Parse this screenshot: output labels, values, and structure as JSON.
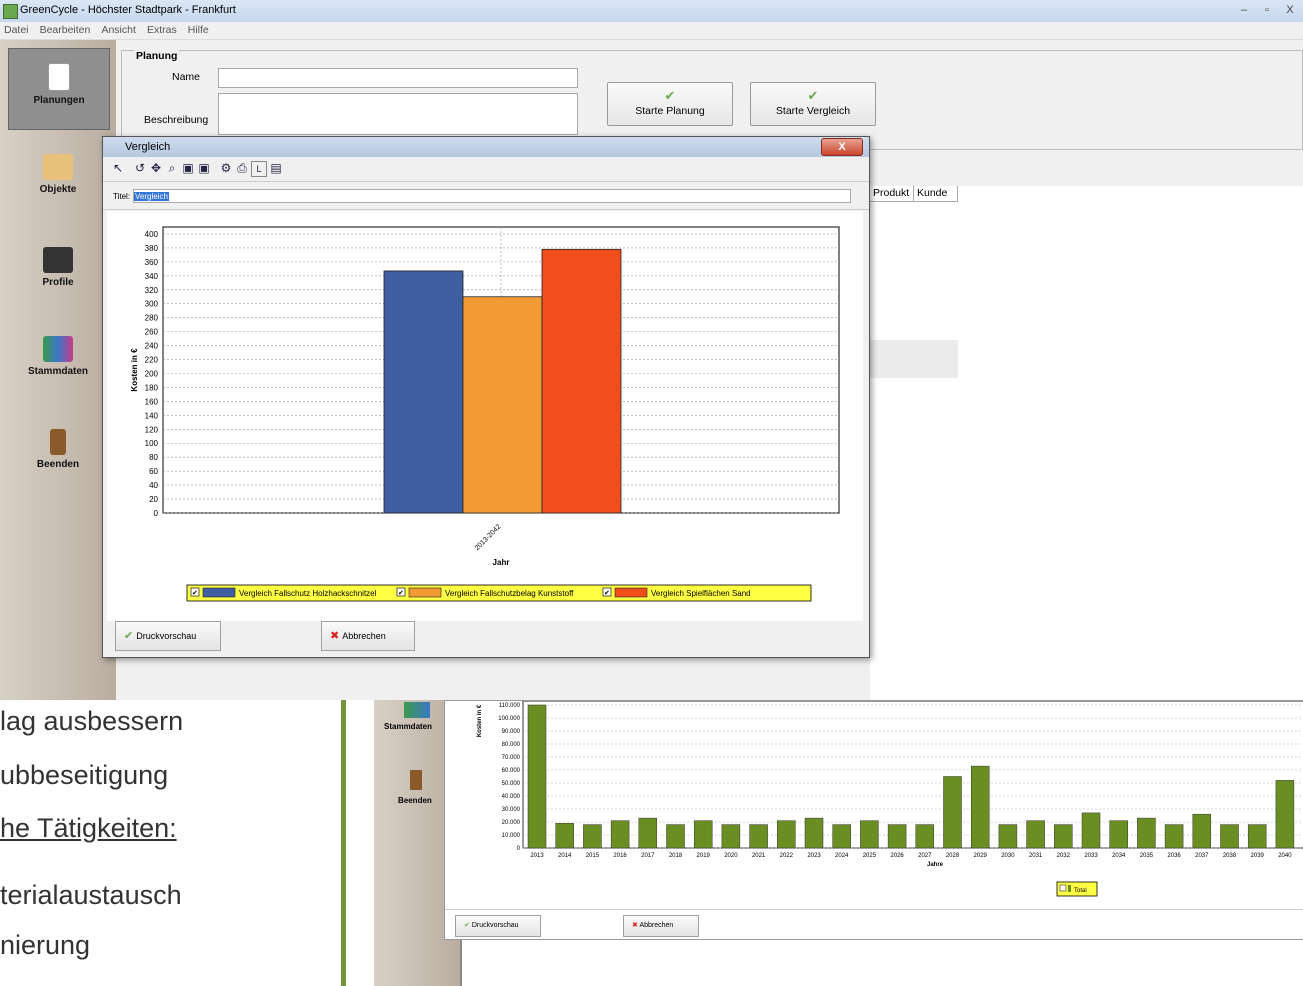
{
  "window": {
    "title": "GreenCycle - Höchster Stadtpark - Frankfurt",
    "buttons": {
      "minimize": "–",
      "maximize": "▫",
      "close": "X"
    }
  },
  "menu": {
    "items": [
      "Datei",
      "Bearbeiten",
      "Ansicht",
      "Extras",
      "Hilfe"
    ]
  },
  "sidebar": {
    "items": [
      {
        "label": "Planungen",
        "icon": "document-icon"
      },
      {
        "label": "Objekte",
        "icon": "map-icon"
      },
      {
        "label": "Profile",
        "icon": "monitor-icon"
      },
      {
        "label": "Stammdaten",
        "icon": "books-icon"
      },
      {
        "label": "Beenden",
        "icon": "door-icon"
      }
    ]
  },
  "planung": {
    "legend": "Planung",
    "name_label": "Name",
    "beschreibung_label": "Beschreibung",
    "name_value": "",
    "beschreibung_value": "",
    "start_planung": "Starte Planung",
    "start_vergleich": "Starte Vergleich"
  },
  "table": {
    "columns": [
      "Produkt",
      "Kunde"
    ]
  },
  "dialog": {
    "title": "Vergleich",
    "close": "X",
    "titel_label": "Titel:",
    "titel_value": "Vergleich",
    "druckvorschau": "Druckvorschau",
    "abbrechen": "Abbrechen"
  },
  "chart_data": [
    {
      "type": "bar",
      "categories": [
        "2013-2042"
      ],
      "series": [
        {
          "name": "Vergleich Fallschutz Holzhackschnitzel",
          "values": [
            347
          ],
          "color": "#3f5fa0"
        },
        {
          "name": "Vergleich Fallschutzbelag Kunststoff",
          "values": [
            310
          ],
          "color": "#f29b35"
        },
        {
          "name": "Vergleich Spielflächen Sand",
          "values": [
            378
          ],
          "color": "#f04e1a"
        }
      ],
      "xlabel": "Jahr",
      "ylabel": "Kosten in €",
      "ylim": [
        0,
        410
      ],
      "yticks": [
        0,
        20,
        40,
        60,
        80,
        100,
        120,
        140,
        160,
        180,
        200,
        220,
        240,
        260,
        280,
        300,
        320,
        340,
        360,
        380,
        400
      ],
      "grid": true,
      "legend": "bottom"
    },
    {
      "type": "bar",
      "categories": [
        "2013",
        "2014",
        "2015",
        "2016",
        "2017",
        "2018",
        "2019",
        "2020",
        "2021",
        "2022",
        "2023",
        "2024",
        "2025",
        "2026",
        "2027",
        "2028",
        "2029",
        "2030",
        "2031",
        "2032",
        "2033",
        "2034",
        "2035",
        "2036",
        "2037",
        "2038",
        "2039",
        "2040"
      ],
      "series": [
        {
          "name": "Total",
          "values": [
            110000,
            19000,
            18000,
            21000,
            23000,
            18000,
            21000,
            18000,
            18000,
            21000,
            23000,
            18000,
            21000,
            18000,
            18000,
            55000,
            63000,
            18000,
            21000,
            18000,
            27000,
            21000,
            23000,
            18000,
            26000,
            18000,
            18000,
            52000
          ],
          "color": "#6b8e23"
        }
      ],
      "xlabel": "Jahre",
      "ylabel": "Kosten in €",
      "yticks": [
        "0",
        "10.000",
        "20.000",
        "30.000",
        "40.000",
        "50.000",
        "60.000",
        "70.000",
        "80.000",
        "90.000",
        "100.000",
        "110.000"
      ],
      "ylim": [
        0,
        110000
      ],
      "grid": true,
      "legend": "bottom"
    }
  ],
  "slide": {
    "lines": [
      "lag ausbessern",
      "ubbeseitigung",
      "he Tätigkeiten:",
      "terialaustausch",
      "nierung"
    ]
  },
  "second": {
    "sidebar": [
      "Stammdaten",
      "Beenden"
    ],
    "druckvorschau": "Druckvorschau",
    "abbrechen": "Abbrechen"
  },
  "colors": {
    "accent_green": "#77933c"
  }
}
